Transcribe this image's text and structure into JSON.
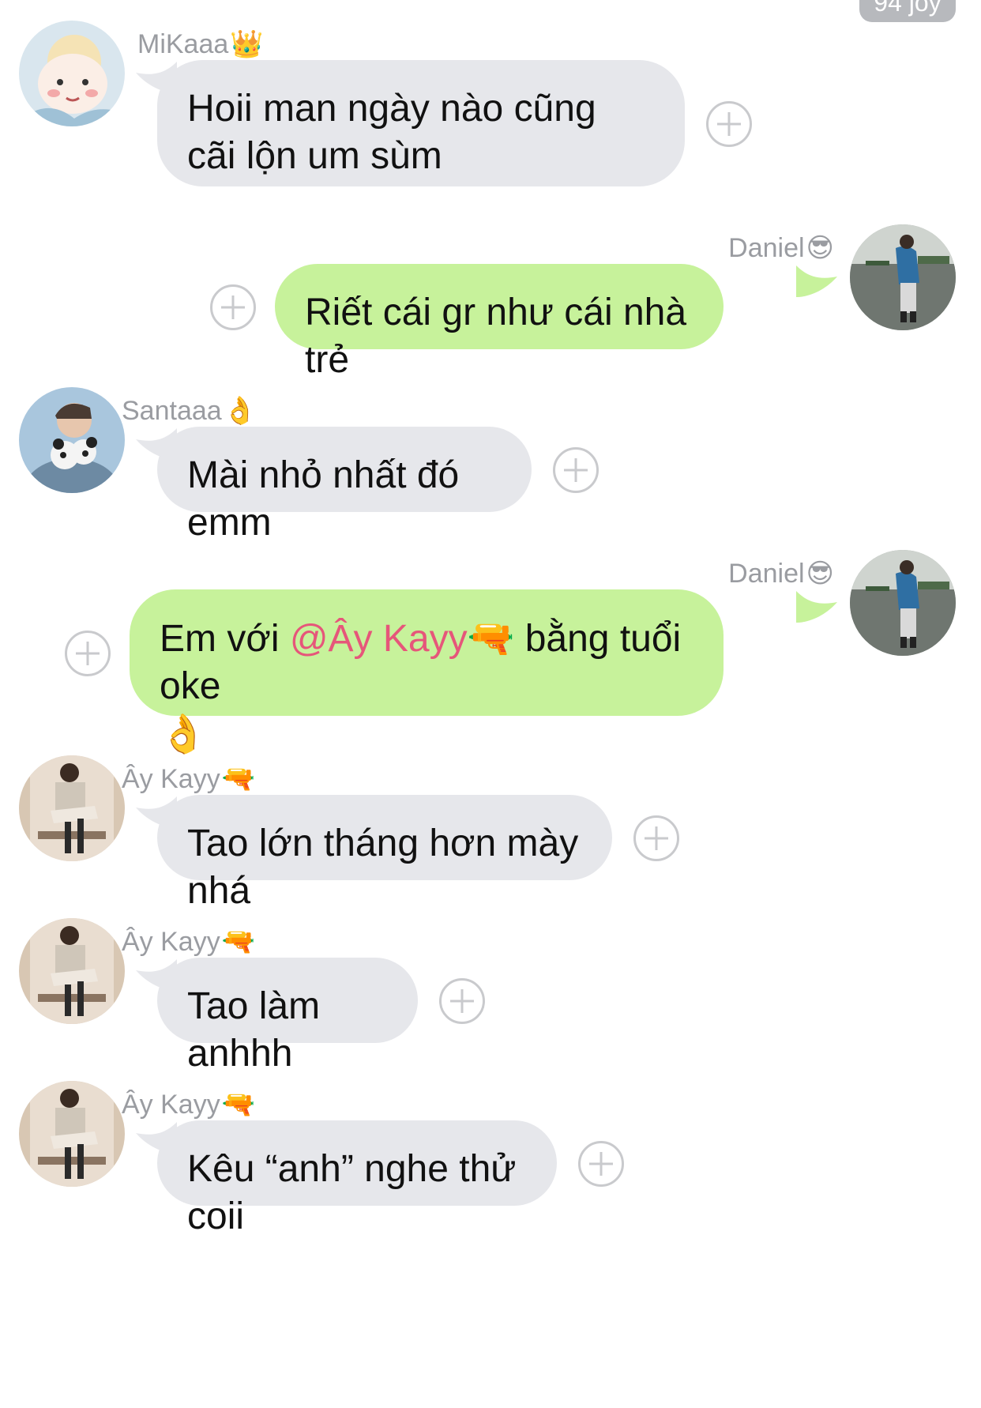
{
  "header": {
    "badge": "94 joy"
  },
  "messages": [
    {
      "direction": "in",
      "sender": "MiKaaa",
      "sender_emoji": "👑",
      "text": "Hoii man ngày nào cũng cãi lộn um sùm",
      "avatar": "mikaaa-avatar",
      "react_icon": "plus-circle-icon"
    },
    {
      "direction": "out",
      "sender": "Daniel",
      "sender_emoji": "😎",
      "text": "Riết cái gr như cái nhà trẻ",
      "avatar": "daniel-avatar",
      "react_icon": "plus-circle-icon"
    },
    {
      "direction": "in",
      "sender": "Santaaa",
      "sender_emoji": "👌",
      "text": "Mài nhỏ nhất đó emm",
      "avatar": "santaaa-avatar",
      "react_icon": "plus-circle-icon"
    },
    {
      "direction": "out",
      "sender": "Daniel",
      "sender_emoji": "😎",
      "text_before": "Em với ",
      "mention": "@Ây Kayy",
      "mention_emoji": "🔫",
      "text_after": " bằng tuổi oke",
      "trailing_emoji": "👌",
      "avatar": "daniel-avatar",
      "react_icon": "plus-circle-icon"
    },
    {
      "direction": "in",
      "sender": "Ây Kayy",
      "sender_emoji": "🔫",
      "text": "Tao lớn tháng hơn mày nhá",
      "avatar": "ay-kayy-avatar",
      "react_icon": "plus-circle-icon"
    },
    {
      "direction": "in",
      "sender": "Ây Kayy",
      "sender_emoji": "🔫",
      "text": "Tao làm anhhh",
      "avatar": "ay-kayy-avatar",
      "react_icon": "plus-circle-icon"
    },
    {
      "direction": "in",
      "sender": "Ây Kayy",
      "sender_emoji": "🔫",
      "text": "Kêu “anh” nghe thử coii",
      "avatar": "ay-kayy-avatar",
      "react_icon": "plus-circle-icon"
    }
  ],
  "colors": {
    "incoming_bubble": "#e6e7eb",
    "outgoing_bubble": "#c7f29b",
    "mention": "#e6567a",
    "sender_name": "#9a9ca1",
    "react_icon": "#c9cacd"
  }
}
